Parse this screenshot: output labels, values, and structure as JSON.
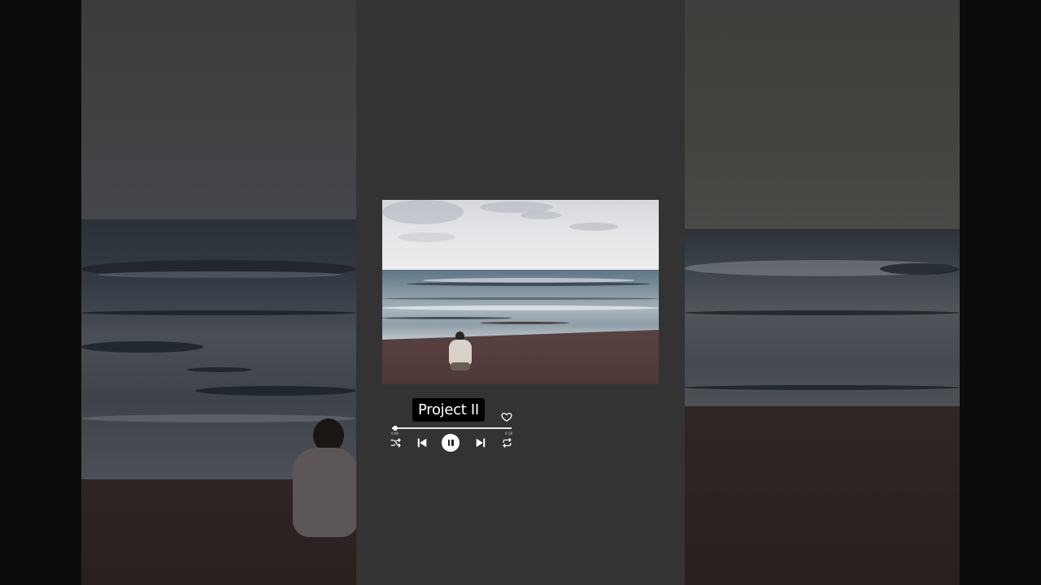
{
  "player": {
    "track_title": "Project II",
    "time_elapsed": "0:00",
    "time_total": "0:18",
    "progress_fraction": 0.03,
    "state": "playing",
    "liked": false
  },
  "icons": {
    "like": "heart-outline-icon",
    "shuffle": "shuffle-icon",
    "previous": "skip-previous-icon",
    "play_pause": "pause-icon",
    "next": "skip-next-icon",
    "repeat": "repeat-icon"
  },
  "colors": {
    "panel": "#333333",
    "chip": "#000000",
    "accent": "#ffffff"
  }
}
